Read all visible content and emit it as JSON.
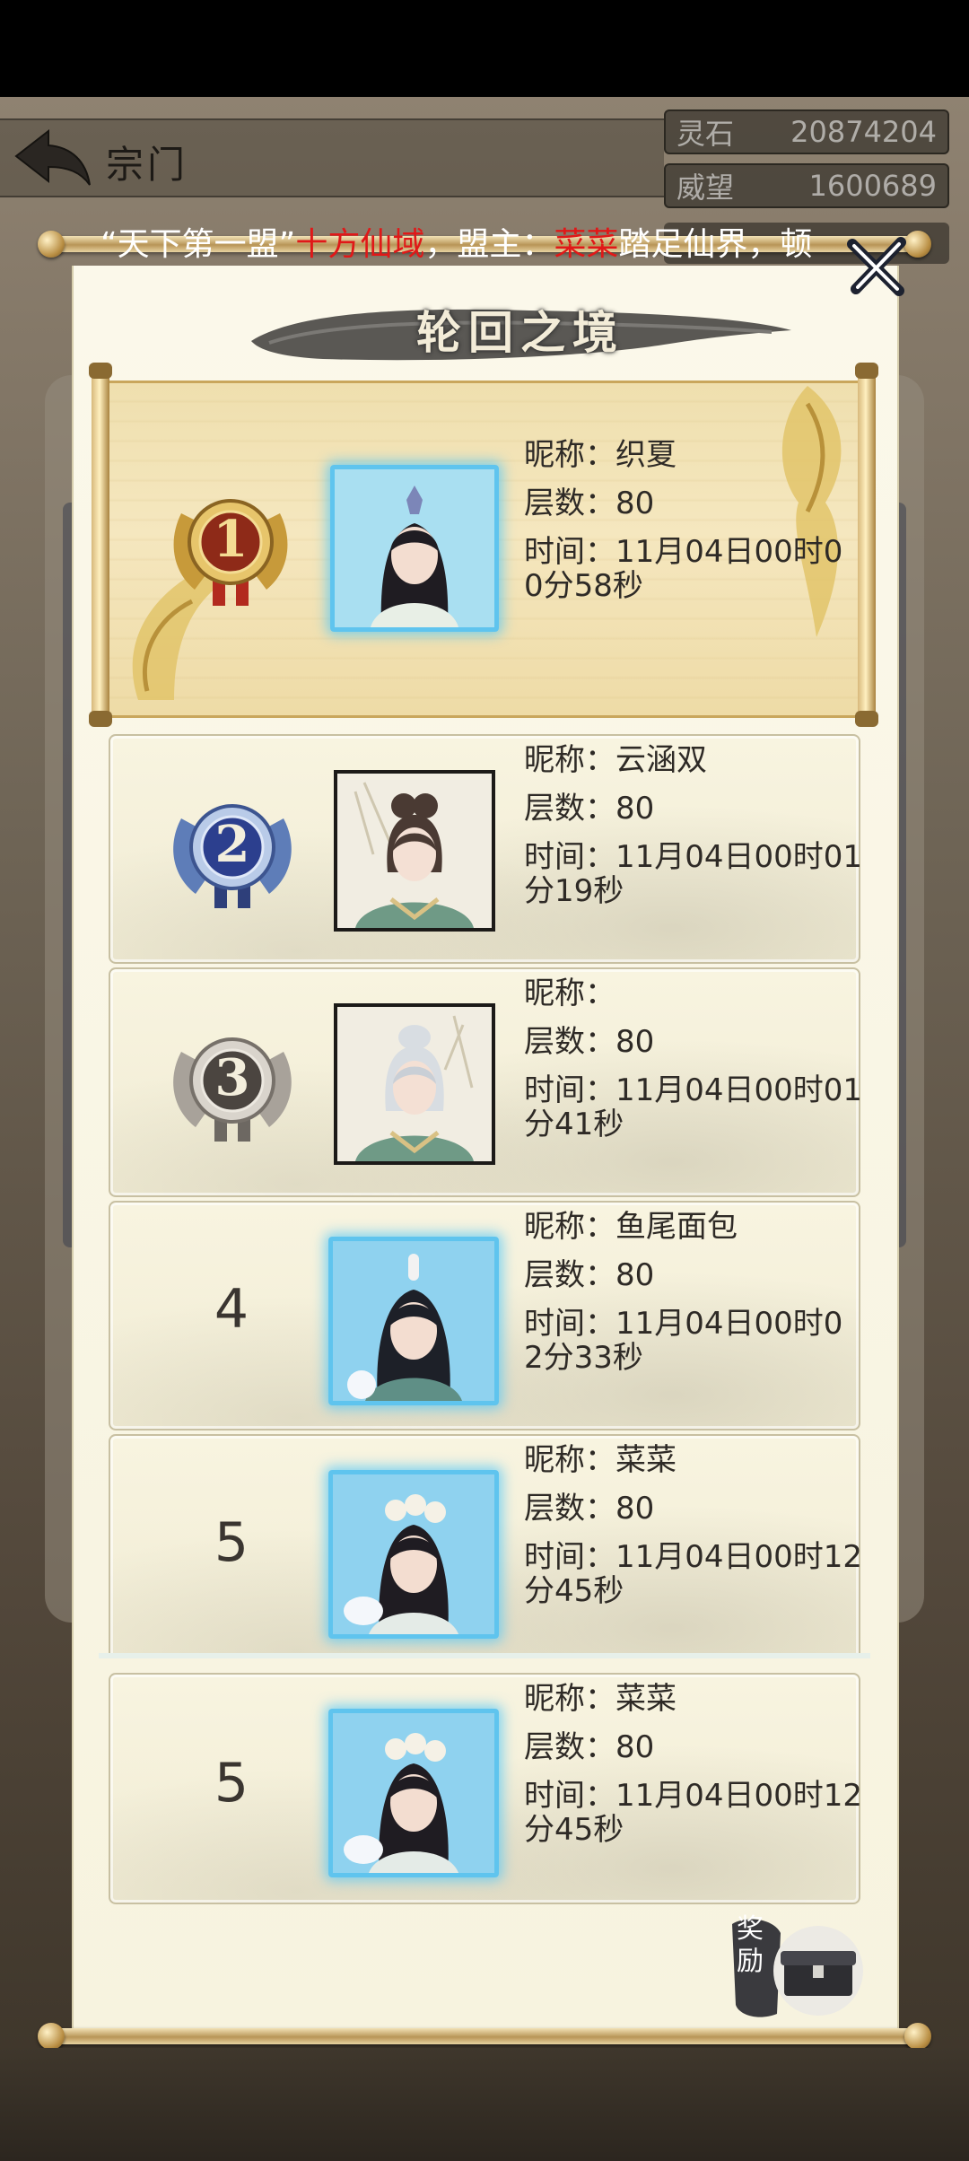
{
  "header": {
    "sect_title": "宗门",
    "resources": [
      {
        "label": "灵石",
        "value": "20874204"
      },
      {
        "label": "威望",
        "value": "1600689"
      }
    ]
  },
  "marquee": {
    "parts": [
      {
        "text": "“天下第一盟”",
        "color": "white"
      },
      {
        "text": "十方仙域",
        "color": "red"
      },
      {
        "text": "，盟主：",
        "color": "white"
      },
      {
        "text": "菜菜",
        "color": "red"
      },
      {
        "text": "踏足仙界，顿",
        "color": "white"
      }
    ]
  },
  "popup": {
    "title": "轮回之境",
    "close_icon": "close-x-icon",
    "reward_label": "奖励"
  },
  "labels": {
    "nickname": "昵称：",
    "floors": "层数：",
    "time": "时间："
  },
  "rankings": [
    {
      "rank": "1",
      "nickname": "织夏",
      "floors": "80",
      "time_line1": "11月04日00时0",
      "time_line2": "0分58秒",
      "portrait": "female-portrait-crowned",
      "frame": "glow"
    },
    {
      "rank": "2",
      "nickname": "云涵双",
      "floors": "80",
      "time_line1": "11月04日00时01",
      "time_line2": "分19秒",
      "portrait": "female-portrait-dark-hair",
      "frame": "plain"
    },
    {
      "rank": "3",
      "nickname": "",
      "floors": "80",
      "time_line1": "11月04日00时01",
      "time_line2": "分41秒",
      "portrait": "female-portrait-white-hair",
      "frame": "plain"
    },
    {
      "rank": "4",
      "nickname": "鱼尾面包",
      "floors": "80",
      "time_line1": "11月04日00时0",
      "time_line2": "2分33秒",
      "portrait": "male-portrait",
      "frame": "glow"
    },
    {
      "rank": "5",
      "nickname": "菜菜",
      "floors": "80",
      "time_line1": "11月04日00时12",
      "time_line2": "分45秒",
      "portrait": "female-portrait-flowers",
      "frame": "glow"
    }
  ],
  "my_rank": {
    "rank": "5",
    "nickname": "菜菜",
    "floors": "80",
    "time_line1": "11月04日00时12",
    "time_line2": "分45秒",
    "portrait": "female-portrait-flowers",
    "frame": "glow"
  },
  "colors": {
    "marquee_red": "#e01818",
    "glow_frame": "#5fc4ee",
    "rank1_gold": "#c9a65c"
  }
}
